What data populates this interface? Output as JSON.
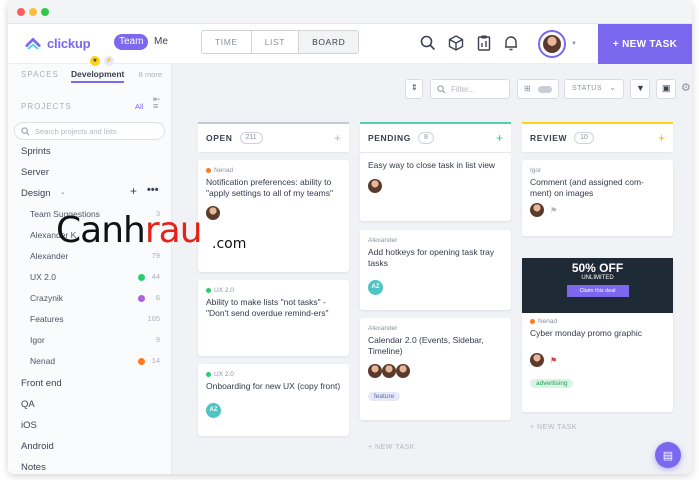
{
  "header": {
    "logo": "clickup",
    "team_label": "Team",
    "me_label": "Me",
    "view_tabs": [
      "TIME",
      "LIST",
      "BOARD"
    ],
    "new_task_label": "+ NEW TASK"
  },
  "sidebar": {
    "spaces_label": "SPACES",
    "space_name": "Development",
    "more_label": "8 more",
    "projects_label": "PROJECTS",
    "all_label": "All",
    "search_placeholder": "Search projects and lists",
    "top_items": [
      "Sprints",
      "Server",
      "Design"
    ],
    "design_children": [
      {
        "label": "Team Suggestions",
        "count": "3",
        "dot": ""
      },
      {
        "label": "Alexander K",
        "count": "",
        "dot": ""
      },
      {
        "label": "Alexander",
        "count": "79",
        "dot": ""
      },
      {
        "label": "UX 2.0",
        "count": "44",
        "dot": "#2ecc71"
      },
      {
        "label": "Crazynik",
        "count": "6",
        "dot": "#b15fe0"
      },
      {
        "label": "Features",
        "count": "105",
        "dot": ""
      },
      {
        "label": "Igor",
        "count": "9",
        "dot": ""
      },
      {
        "label": "Nenad",
        "count": "14",
        "dot": "#ff7a1a"
      }
    ],
    "bottom_items": [
      "Front end",
      "QA",
      "iOS",
      "Android",
      "Notes"
    ]
  },
  "toolbar": {
    "filter_placeholder": "Filter...",
    "status_label": "STATUS"
  },
  "columns": [
    {
      "name": "OPEN",
      "count": "211",
      "color": "#c5c9d1",
      "plus_color": "#b5bac4",
      "cards": [
        {
          "meta": "Nenad",
          "meta_color": "#ff7a1a",
          "title": "Notification preferences: ability to \"apply settings to all of my teams\""
        },
        {
          "meta": "UX 2.0",
          "meta_color": "#2ecc71",
          "title": "Ability to make lists \"not tasks\" - \"Don't send overdue remind-ers\""
        },
        {
          "meta": "UX 2.0",
          "meta_color": "#2ecc71",
          "title": "Onboarding for new UX (copy front)"
        }
      ]
    },
    {
      "name": "PENDING",
      "count": "8",
      "color": "#4fd1b0",
      "plus_color": "#2ecc9a",
      "cards": [
        {
          "meta": "",
          "title": "Easy way to close task in list view"
        },
        {
          "meta": "Alexander",
          "title": "Add hotkeys for opening task tray tasks"
        },
        {
          "meta": "Alexander",
          "title": "Calendar 2.0 (Events, Sidebar, Timeline)",
          "tag": "feature"
        }
      ],
      "new_task": "+ NEW TASK"
    },
    {
      "name": "REVIEW",
      "count": "10",
      "color": "#ffd21a",
      "plus_color": "#f5b800",
      "cards": [
        {
          "meta": "Igor",
          "title": "Comment (and assigned com-ment) on images"
        },
        {
          "meta": "Nenad",
          "meta_color": "#ff7a1a",
          "title": "Cyber monday promo graphic",
          "tag": "advertising"
        }
      ],
      "promo": {
        "headline": "50% OFF",
        "sub": "UNLIMITED",
        "button": "Claim this deal"
      },
      "new_task": "+ NEW TASK"
    }
  ],
  "watermark": {
    "main_a": "Canh",
    "main_b": "rau",
    "suffix": ".com"
  }
}
